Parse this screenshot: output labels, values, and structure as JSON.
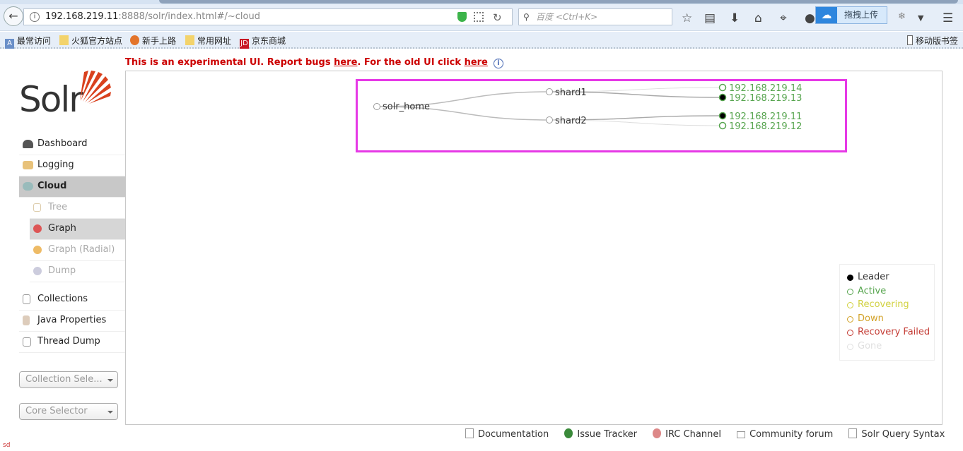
{
  "browser": {
    "url_host": "192.168.219.11",
    "url_rest": ":8888/solr/index.html#/~cloud",
    "search_placeholder": "百度 <Ctrl+K>",
    "upload_label": "拖拽上传",
    "bookmarks": [
      "最常访问",
      "火狐官方站点",
      "新手上路",
      "常用网址",
      "京东商城"
    ],
    "mobile_bookmarks": "移动版书签"
  },
  "banner": {
    "text1": "This is an experimental UI. Report bugs ",
    "link1": "here",
    "text2": ". For the old UI click ",
    "link2": "here"
  },
  "logo": "Solr",
  "menu": {
    "items": [
      {
        "label": "Dashboard"
      },
      {
        "label": "Logging"
      },
      {
        "label": "Cloud"
      }
    ],
    "cloud_sub": [
      {
        "label": "Tree"
      },
      {
        "label": "Graph"
      },
      {
        "label": "Graph (Radial)"
      },
      {
        "label": "Dump"
      }
    ],
    "items2": [
      {
        "label": "Collections"
      },
      {
        "label": "Java Properties"
      },
      {
        "label": "Thread Dump"
      }
    ],
    "collection_selector": "Collection Sele...",
    "core_selector": "Core Selector"
  },
  "graph": {
    "root": "solr_home",
    "shards": [
      {
        "name": "shard1",
        "replicas": [
          {
            "host": "192.168.219.14",
            "state": "active",
            "leader": false
          },
          {
            "host": "192.168.219.13",
            "state": "active",
            "leader": true
          }
        ]
      },
      {
        "name": "shard2",
        "replicas": [
          {
            "host": "192.168.219.11",
            "state": "active",
            "leader": true
          },
          {
            "host": "192.168.219.12",
            "state": "active",
            "leader": false
          }
        ]
      }
    ]
  },
  "legend": [
    {
      "label": "Leader",
      "color": "#000000"
    },
    {
      "label": "Active",
      "color": "#57a54f"
    },
    {
      "label": "Recovering",
      "color": "#d1d13f"
    },
    {
      "label": "Down",
      "color": "#d3a32a"
    },
    {
      "label": "Recovery Failed",
      "color": "#c43c35"
    },
    {
      "label": "Gone",
      "color": "#e0e0e0"
    }
  ],
  "footer": [
    "Documentation",
    "Issue Tracker",
    "IRC Channel",
    "Community forum",
    "Solr Query Syntax"
  ],
  "corner_text": "sd"
}
